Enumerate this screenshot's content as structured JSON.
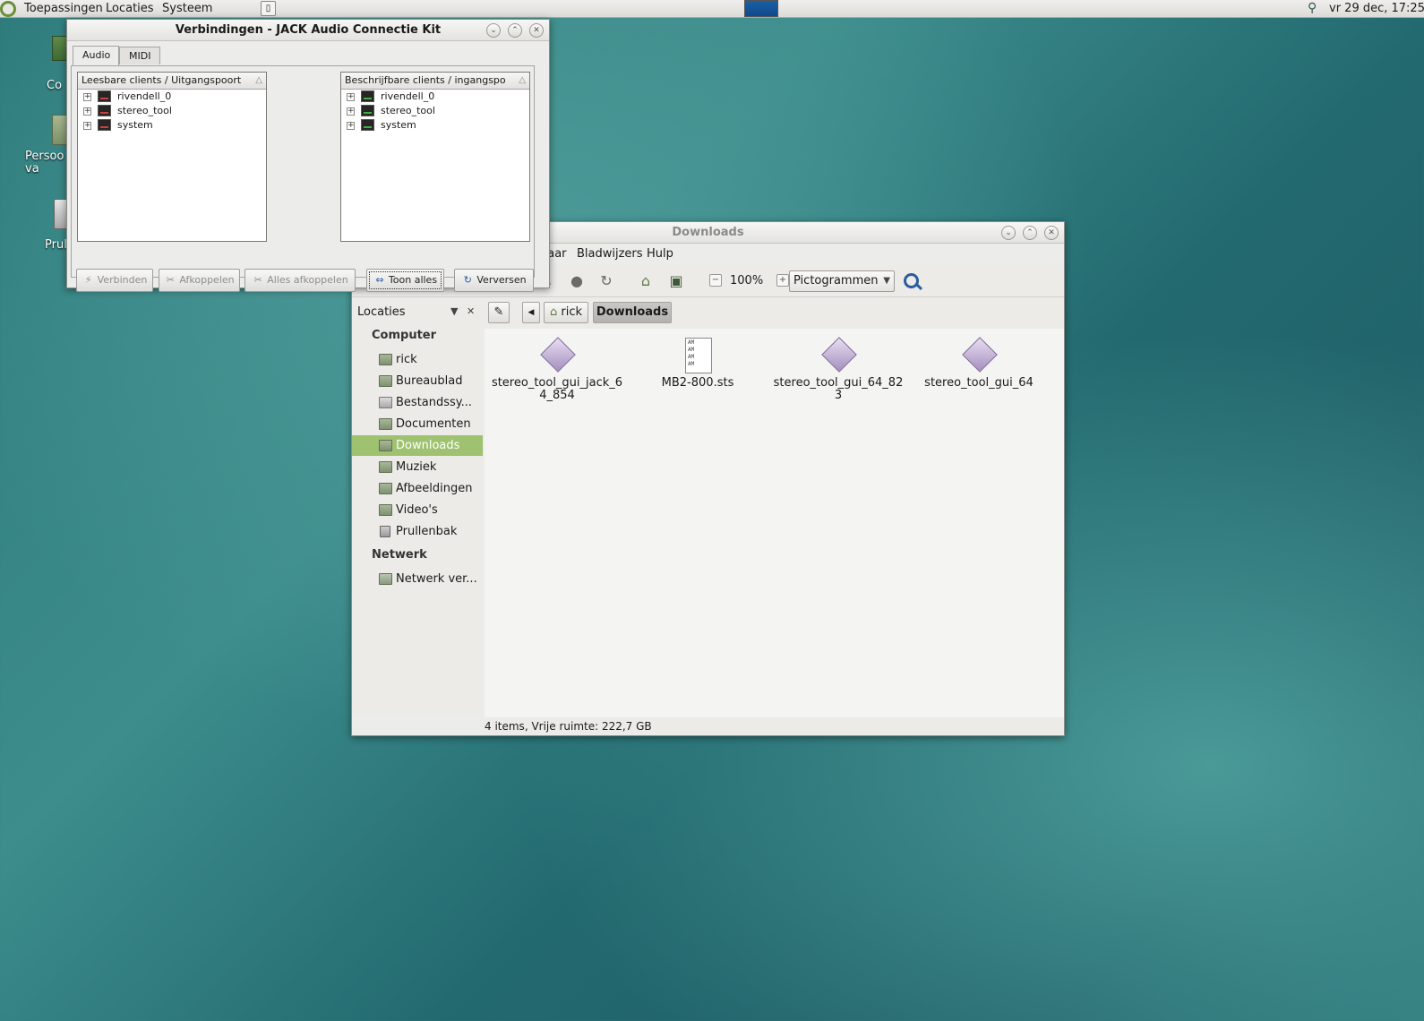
{
  "panel": {
    "menus": [
      "Toepassingen",
      "Locaties",
      "Systeem"
    ],
    "clock": "vr 29 dec, 17:25"
  },
  "desktop": {
    "icons": [
      "Co",
      "Persoo va",
      "Prul"
    ]
  },
  "jack": {
    "title": "Verbindingen - JACK Audio Connectie Kit",
    "tabs": [
      "Audio",
      "MIDI"
    ],
    "left_header": "Leesbare clients / Uitgangspoort",
    "right_header": "Beschrijfbare clients / ingangspo",
    "left_clients": [
      "rivendell_0",
      "stereo_tool",
      "system"
    ],
    "right_clients": [
      "rivendell_0",
      "stereo_tool",
      "system"
    ],
    "buttons": {
      "connect": "Verbinden",
      "disconnect": "Afkoppelen",
      "disconnect_all": "Alles afkoppelen",
      "show_all": "Toon alles",
      "refresh": "Verversen"
    }
  },
  "nautilus": {
    "title": "Downloads",
    "menu": [
      "naar",
      "Bladwijzers",
      "Hulp"
    ],
    "zoom": "100%",
    "view_mode": "Pictogrammen",
    "sidebar": {
      "header": "Locaties",
      "computer_label": "Computer",
      "network_label": "Netwerk",
      "items": [
        "rick",
        "Bureaublad",
        "Bestandssy...",
        "Documenten",
        "Downloads",
        "Muziek",
        "Afbeeldingen",
        "Video's",
        "Prullenbak"
      ],
      "network_items": [
        "Netwerk ver..."
      ],
      "selected": "Downloads"
    },
    "path": [
      "rick",
      "Downloads"
    ],
    "files": [
      {
        "name": "stereo_tool_gui_jack_64_854",
        "type": "executable"
      },
      {
        "name": "MB2-800.sts",
        "type": "text"
      },
      {
        "name": "stereo_tool_gui_64_823",
        "type": "executable"
      },
      {
        "name": "stereo_tool_gui_64",
        "type": "executable"
      }
    ],
    "status": "4 items, Vrije ruimte: 222,7 GB"
  }
}
